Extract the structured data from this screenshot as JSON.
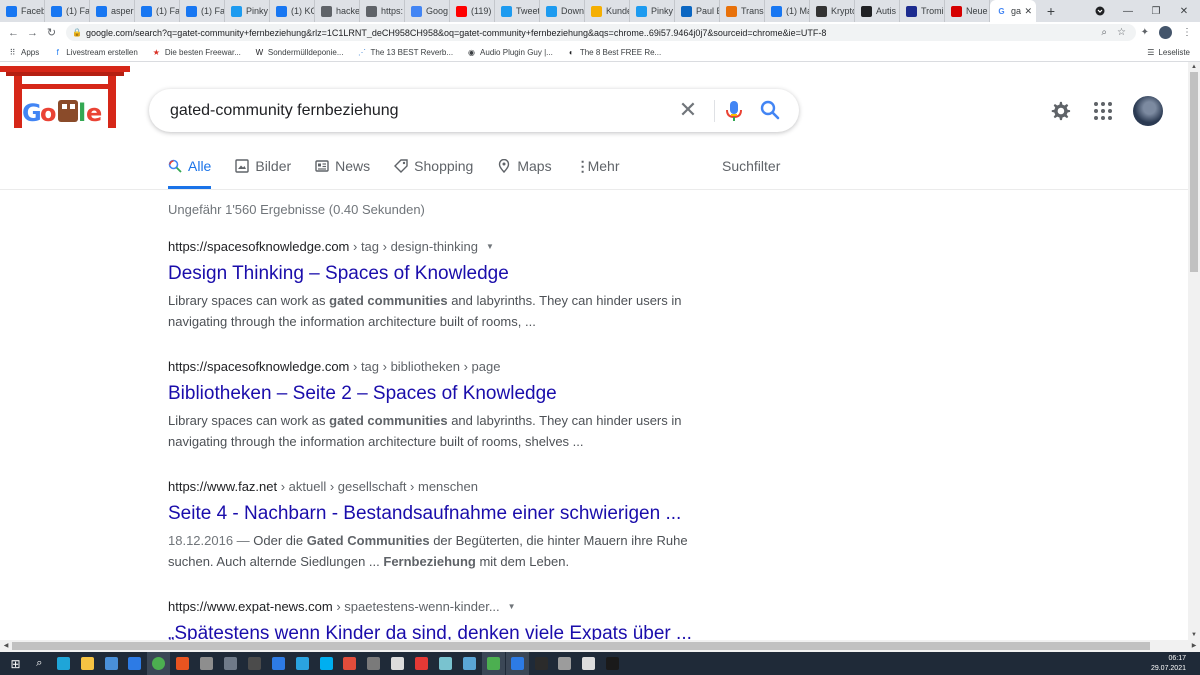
{
  "browser": {
    "tabs": [
      {
        "label": "Faceb",
        "icon": "facebook-icon",
        "color": "#1877f2"
      },
      {
        "label": "(1) Fa",
        "icon": "facebook-icon",
        "color": "#1877f2"
      },
      {
        "label": "asper",
        "icon": "facebook-icon",
        "color": "#1877f2"
      },
      {
        "label": "(1) Fa",
        "icon": "facebook-icon",
        "color": "#1877f2"
      },
      {
        "label": "(1) Fa",
        "icon": "facebook-icon",
        "color": "#1877f2"
      },
      {
        "label": "Pinky",
        "icon": "twitter-icon",
        "color": "#1d9bf0"
      },
      {
        "label": "(1) KC",
        "icon": "facebook-icon",
        "color": "#1877f2"
      },
      {
        "label": "hacke",
        "icon": "globe-icon",
        "color": "#5f6368"
      },
      {
        "label": "https:",
        "icon": "globe-icon",
        "color": "#5f6368"
      },
      {
        "label": "Goog",
        "icon": "docs-icon",
        "color": "#4285f4"
      },
      {
        "label": "(119)",
        "icon": "youtube-icon",
        "color": "#ff0000"
      },
      {
        "label": "Tweet",
        "icon": "tweetdeck-icon",
        "color": "#1d9bf0"
      },
      {
        "label": "Down",
        "icon": "twitter-icon",
        "color": "#1d9bf0"
      },
      {
        "label": "Kunde",
        "icon": "ebay-icon",
        "color": "#f5af02"
      },
      {
        "label": "Pinky",
        "icon": "twitter-icon",
        "color": "#1d9bf0"
      },
      {
        "label": "Paul E",
        "icon": "linkedin-icon",
        "color": "#0a66c2"
      },
      {
        "label": "Transc",
        "icon": "transcript-icon",
        "color": "#e8710a"
      },
      {
        "label": "(1) Ma",
        "icon": "facebook-icon",
        "color": "#1877f2"
      },
      {
        "label": "Krypto",
        "icon": "wikipedia-icon",
        "color": "#333333"
      },
      {
        "label": "Autis",
        "icon": "star-icon",
        "color": "#202124"
      },
      {
        "label": "Tromi",
        "icon": "news-icon",
        "color": "#1c2b8f"
      },
      {
        "label": "Neue",
        "icon": "zeit-icon",
        "color": "#d50000"
      }
    ],
    "active_tab": {
      "label": "ga",
      "icon": "google-icon"
    },
    "url": "google.com/search?q=gatet-community+fernbeziehung&rlz=1C1LRNT_deCH958CH958&oq=gatet-community+fernbeziehung&aqs=chrome..69i57.9464j0j7&sourceid=chrome&ie=UTF-8",
    "bookmarks": [
      {
        "label": "Apps",
        "icon": "apps-grid-icon"
      },
      {
        "label": "Livestream erstellen",
        "icon": "facebook-icon"
      },
      {
        "label": "Die besten Freewar...",
        "icon": "star-red-icon"
      },
      {
        "label": "Sondermülldeponie...",
        "icon": "w-icon"
      },
      {
        "label": "The 13 BEST Reverb...",
        "icon": "plugin-icon"
      },
      {
        "label": "Audio Plugin Guy |...",
        "icon": "audio-plugin-icon"
      },
      {
        "label": "The 8 Best FREE Re...",
        "icon": "moon-icon"
      }
    ],
    "reading_list": "Leseliste"
  },
  "search": {
    "query": "gated-community fernbeziehung",
    "tabs": [
      {
        "label": "Alle",
        "icon": "search-icon",
        "active": true
      },
      {
        "label": "Bilder",
        "icon": "image-icon",
        "active": false
      },
      {
        "label": "News",
        "icon": "news-icon",
        "active": false
      },
      {
        "label": "Shopping",
        "icon": "tag-icon",
        "active": false
      },
      {
        "label": "Maps",
        "icon": "map-pin-icon",
        "active": false
      },
      {
        "label": "Mehr",
        "icon": "more-vert-icon",
        "active": false
      }
    ],
    "filter_label": "Suchfilter",
    "stats": "Ungefähr 1'560 Ergebnisse (0.40 Sekunden)"
  },
  "results": [
    {
      "domain": "https://spacesofknowledge.com",
      "crumbs": " › tag › design-thinking",
      "has_menu": true,
      "title": "Design Thinking – Spaces of Knowledge",
      "snippet": [
        {
          "t": "Library spaces can work as ",
          "b": false
        },
        {
          "t": "gated communities",
          "b": true
        },
        {
          "t": " and labyrinths. They can hinder users in navigating through the information architecture built of rooms, ...",
          "b": false
        }
      ]
    },
    {
      "domain": "https://spacesofknowledge.com",
      "crumbs": " › tag › bibliotheken › page",
      "has_menu": false,
      "title": "Bibliotheken – Seite 2 – Spaces of Knowledge",
      "snippet": [
        {
          "t": "Library spaces can work as ",
          "b": false
        },
        {
          "t": "gated communities",
          "b": true
        },
        {
          "t": " and labyrinths. They can hinder users in navigating through the information architecture built of rooms, shelves ...",
          "b": false
        }
      ]
    },
    {
      "domain": "https://www.faz.net",
      "crumbs": " › aktuell › gesellschaft › menschen",
      "has_menu": false,
      "title": "Seite 4 - Nachbarn - Bestandsaufnahme einer schwierigen ...",
      "date": "18.12.2016 — ",
      "snippet": [
        {
          "t": "Oder die ",
          "b": false
        },
        {
          "t": "Gated Communities",
          "b": true
        },
        {
          "t": " der Begüterten, die hinter Mauern ihre Ruhe suchen. Auch alternde Siedlungen ... ",
          "b": false
        },
        {
          "t": "Fernbeziehung",
          "b": true
        },
        {
          "t": " mit dem Leben.",
          "b": false
        }
      ]
    },
    {
      "domain": "https://www.expat-news.com",
      "crumbs": " › spaetestens-wenn-kinder...",
      "has_menu": true,
      "title": "„Spätestens wenn Kinder da sind, denken viele Expats über ...",
      "snippet": []
    }
  ],
  "taskbar": {
    "apps": [
      {
        "name": "start-icon",
        "color": "#ffffff"
      },
      {
        "name": "search-icon",
        "color": "#ffffff"
      },
      {
        "name": "edge-icon",
        "color": "#1fa5d8"
      },
      {
        "name": "file-explorer-icon",
        "color": "#f6c343"
      },
      {
        "name": "store-icon",
        "color": "#4a90d9"
      },
      {
        "name": "mail-icon",
        "color": "#2d7be5"
      },
      {
        "name": "chrome-icon",
        "color": "#4caf50",
        "active": true
      },
      {
        "name": "ubuntu-icon",
        "color": "#e95420"
      },
      {
        "name": "game-icon",
        "color": "#8e8e8e"
      },
      {
        "name": "vpn-icon",
        "color": "#6f7a89"
      },
      {
        "name": "live-icon",
        "color": "#4b4b4b"
      },
      {
        "name": "cloud-icon",
        "color": "#2d7be5"
      },
      {
        "name": "telegram-icon",
        "color": "#2aa3e0"
      },
      {
        "name": "skype-icon",
        "color": "#00aff0"
      },
      {
        "name": "screen-icon",
        "color": "#e24d3b"
      },
      {
        "name": "keyboard-icon",
        "color": "#7a7a7a"
      },
      {
        "name": "capcut-icon",
        "color": "#dcdcdc"
      },
      {
        "name": "wetter-icon",
        "color": "#e53935"
      },
      {
        "name": "vm-icon",
        "color": "#79c3cf"
      },
      {
        "name": "notes-icon",
        "color": "#5aa6d6"
      },
      {
        "name": "wechat-icon",
        "color": "#4caf50",
        "active": true
      },
      {
        "name": "window-icon",
        "color": "#2d7be5",
        "active": true
      },
      {
        "name": "terminal-icon",
        "color": "#2b2b2b"
      },
      {
        "name": "disk-icon",
        "color": "#9c9c9c"
      },
      {
        "name": "pen-icon",
        "color": "#dddddd"
      },
      {
        "name": "console-icon",
        "color": "#1a1a1a"
      }
    ],
    "time": "06:17",
    "date": "29.07.2021"
  }
}
